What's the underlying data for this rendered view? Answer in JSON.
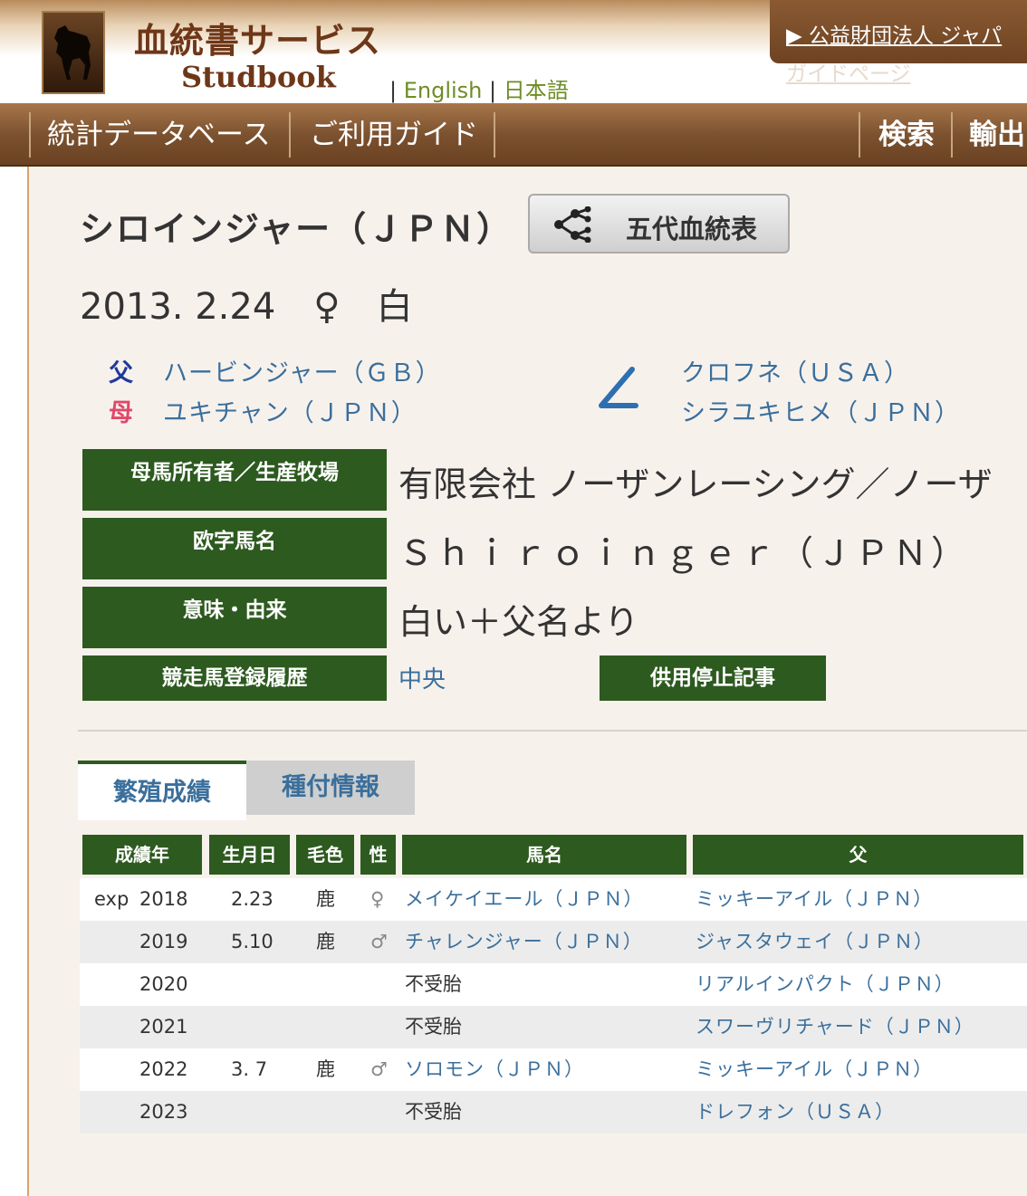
{
  "header": {
    "logo_title": "血統書サービス",
    "logo_sub": "Studbook",
    "lang_sep": "|",
    "lang_english": "English",
    "lang_japanese": "日本語",
    "external_link_1": "公益財団法人 ジャパ",
    "external_link_2": "ガイドページ"
  },
  "nav": {
    "items": [
      "統計データベース",
      "ご利用ガイド"
    ],
    "search": "検索",
    "export": "輸出"
  },
  "horse": {
    "name": "シロインジャー（ＪＰＮ）",
    "pedigree_button": "五代血統表",
    "birth_date": "2013. 2.24",
    "sex": "♀",
    "color": "白",
    "sire_label": "父",
    "sire": "ハービンジャー（ＧＢ）",
    "dam_label": "母",
    "dam": "ユキチャン（ＪＰＮ）",
    "bms_mark": "∠",
    "damsire": "クロフネ（ＵＳＡ）",
    "granddam": "シラユキヒメ（ＪＰＮ）"
  },
  "info": [
    {
      "label": "母馬所有者／生産牧場",
      "value": "有限会社 ノーザンレーシング／ノーザ"
    },
    {
      "label": "欧字馬名",
      "value": "Ｓｈｉｒｏｉｎｇｅｒ（ＪＰＮ）"
    },
    {
      "label": "意味・由来",
      "value": "白い＋父名より"
    },
    {
      "label": "競走馬登録履歴",
      "value": "中央"
    }
  ],
  "stop_button": "供用停止記事",
  "tabs": {
    "active": "繁殖成績",
    "inactive": "種付情報"
  },
  "table": {
    "headers": [
      "成績年",
      "生月日",
      "毛色",
      "性",
      "馬名",
      "父"
    ],
    "rows": [
      {
        "prefix": "exp",
        "year": "2018",
        "date": "2.23",
        "color": "鹿",
        "sex": "♀",
        "name": "メイケイエール（ＪＰＮ）",
        "sire": "ミッキーアイル（ＪＰＮ）"
      },
      {
        "prefix": "",
        "year": "2019",
        "date": "5.10",
        "color": "鹿",
        "sex": "♂",
        "name": "チャレンジャー（ＪＰＮ）",
        "sire": "ジャスタウェイ（ＪＰＮ）"
      },
      {
        "prefix": "",
        "year": "2020",
        "date": "",
        "color": "",
        "sex": "",
        "name": "不受胎",
        "sire": "リアルインパクト（ＪＰＮ）"
      },
      {
        "prefix": "",
        "year": "2021",
        "date": "",
        "color": "",
        "sex": "",
        "name": "不受胎",
        "sire": "スワーヴリチャード（ＪＰＮ）"
      },
      {
        "prefix": "",
        "year": "2022",
        "date": "3. 7",
        "color": "鹿",
        "sex": "♂",
        "name": "ソロモン（ＪＰＮ）",
        "sire": "ミッキーアイル（ＪＰＮ）"
      },
      {
        "prefix": "",
        "year": "2023",
        "date": "",
        "color": "",
        "sex": "",
        "name": "不受胎",
        "sire": "ドレフォン（ＵＳＡ）"
      }
    ]
  },
  "colors": {
    "brand_brown": "#6e3718",
    "label_green": "#2d5a1f",
    "link_blue": "#3a6f9c",
    "sire_label": "#1f3a9a",
    "dam_label": "#e0486a"
  }
}
